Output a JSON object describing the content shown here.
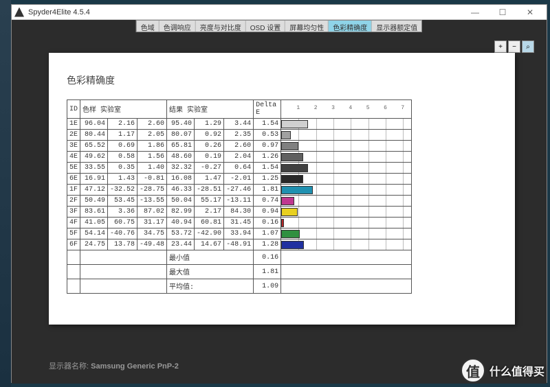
{
  "titlebar": {
    "app": "Spyder4Elite 4.5.4"
  },
  "tabs": [
    "色域",
    "色调响应",
    "亮度与对比度",
    "OSD 设置",
    "屏幕均匀性",
    "色彩精确度",
    "显示器额定值"
  ],
  "active_tab": 5,
  "page_title": "色彩精确度",
  "headers": {
    "id": "ID",
    "sample": "色样 实验室",
    "result": "结果 实验室",
    "delta": "Delta E"
  },
  "scale_ticks": [
    "1",
    "2",
    "3",
    "4",
    "5",
    "6",
    "7"
  ],
  "scale_max": 7.5,
  "rows": [
    {
      "id": "1E",
      "s": [
        96.04,
        2.16,
        2.6
      ],
      "r": [
        95.4,
        1.29,
        3.44
      ],
      "de": 1.54,
      "c": "#d0d0d0"
    },
    {
      "id": "2E",
      "s": [
        80.44,
        1.17,
        2.05
      ],
      "r": [
        80.07,
        0.92,
        2.35
      ],
      "de": 0.53,
      "c": "#a0a0a0"
    },
    {
      "id": "3E",
      "s": [
        65.52,
        0.69,
        1.86
      ],
      "r": [
        65.81,
        0.26,
        2.6
      ],
      "de": 0.97,
      "c": "#808080"
    },
    {
      "id": "4E",
      "s": [
        49.62,
        0.58,
        1.56
      ],
      "r": [
        48.6,
        0.19,
        2.04
      ],
      "de": 1.26,
      "c": "#606060"
    },
    {
      "id": "5E",
      "s": [
        33.55,
        0.35,
        1.4
      ],
      "r": [
        32.32,
        -0.27,
        0.64
      ],
      "de": 1.54,
      "c": "#404040"
    },
    {
      "id": "6E",
      "s": [
        16.91,
        1.43,
        -0.81
      ],
      "r": [
        16.08,
        1.47,
        -2.01
      ],
      "de": 1.25,
      "c": "#282828"
    },
    {
      "id": "1F",
      "s": [
        47.12,
        -32.52,
        -28.75
      ],
      "r": [
        46.33,
        -28.51,
        -27.46
      ],
      "de": 1.81,
      "c": "#2090b0"
    },
    {
      "id": "2F",
      "s": [
        50.49,
        53.45,
        -13.55
      ],
      "r": [
        50.04,
        55.17,
        -13.11
      ],
      "de": 0.74,
      "c": "#c03890"
    },
    {
      "id": "3F",
      "s": [
        83.61,
        3.36,
        87.02
      ],
      "r": [
        82.99,
        2.17,
        84.3
      ],
      "de": 0.94,
      "c": "#e8d020"
    },
    {
      "id": "4F",
      "s": [
        41.05,
        60.75,
        31.17
      ],
      "r": [
        40.94,
        60.81,
        31.45
      ],
      "de": 0.16,
      "c": "#b82828"
    },
    {
      "id": "5F",
      "s": [
        54.14,
        -40.76,
        34.75
      ],
      "r": [
        53.72,
        -42.9,
        33.94
      ],
      "de": 1.07,
      "c": "#309040"
    },
    {
      "id": "6F",
      "s": [
        24.75,
        13.78,
        -49.48
      ],
      "r": [
        23.44,
        14.67,
        -48.91
      ],
      "de": 1.28,
      "c": "#2030a0"
    }
  ],
  "summary": {
    "min_lbl": "最小值",
    "min": 0.16,
    "max_lbl": "最大值",
    "max": 1.81,
    "avg_lbl": "平均值:",
    "avg": 1.09
  },
  "footer": {
    "label": "显示器名称:",
    "value": "Samsung Generic PnP-2"
  },
  "watermark": "什么值得买",
  "watermark_icon": "值"
}
